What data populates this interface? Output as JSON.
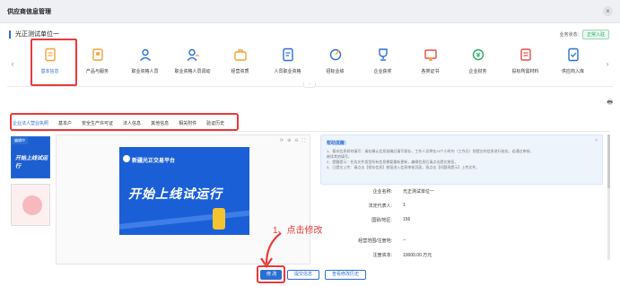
{
  "window": {
    "title": "供应商信息管理",
    "close": "×"
  },
  "company": {
    "name": "光正测试单位一",
    "status_label": "业务状态:",
    "status_value": "正常入驻"
  },
  "nav": [
    {
      "label": "基本信息",
      "icon": "basic-info-icon",
      "active": true
    },
    {
      "label": "产品与服务",
      "icon": "products-icon"
    },
    {
      "label": "职业资格人员",
      "icon": "qualified-staff-icon"
    },
    {
      "label": "职业资格人员调动",
      "icon": "staff-transfer-icon"
    },
    {
      "label": "经营资质",
      "icon": "business-qualification-icon"
    },
    {
      "label": "人员职业资格",
      "icon": "staff-certificate-icon"
    },
    {
      "label": "招标业绩",
      "icon": "bid-performance-icon"
    },
    {
      "label": "企业获奖",
      "icon": "award-icon"
    },
    {
      "label": "各类证书",
      "icon": "certificates-icon"
    },
    {
      "label": "企业财务",
      "icon": "finance-icon"
    },
    {
      "label": "投标所需材料",
      "icon": "bid-materials-icon"
    },
    {
      "label": "供应商入库",
      "icon": "supplier-entry-icon"
    }
  ],
  "tabs": [
    {
      "label": "企业法人营业执照",
      "active": true
    },
    {
      "label": "基本户"
    },
    {
      "label": "安全生产许可证"
    },
    {
      "label": "法人信息"
    },
    {
      "label": "其他信息"
    },
    {
      "label": "相关附件"
    },
    {
      "label": "验证历史"
    }
  ],
  "thumbs": {
    "tag": "编辑中",
    "text": "开始上线试运行"
  },
  "viewer": {
    "brand": "新疆光正交易平台",
    "headline": "开始上线试运行"
  },
  "notice": {
    "heading": "帮助提醒：",
    "lines": [
      "1、基本信息如何填写：请在确认信息准确后填写保存，工作人员将在24个小时内（工作日）到提交的信息进行核实，若通过审核，",
      "      继续其他填写。",
      "2、提醒提示：任务文件类型所有信息需要重新更新，编辑信息后请点击提交按钮，",
      "3、已提交上传：请点击【保存信息】按钮进入信息审核页面，再点击【问题再提示】上传文件。"
    ]
  },
  "form": [
    {
      "label": "企业名称:",
      "value": "光正测试单位一"
    },
    {
      "label": "法定代表人:",
      "value": "1"
    },
    {
      "label": "国别/地区:",
      "value": "156"
    },
    {
      "label": "经营范围/注册地:",
      "value": "--"
    },
    {
      "label": "注册资本:",
      "value": "10000.00 万元"
    }
  ],
  "annotation": "1、点击修改",
  "buttons": {
    "edit": "修 改",
    "save": "提交信息",
    "history": "查看修改历史"
  },
  "colors": {
    "accent": "#2b6fd6",
    "highlight": "#e83a3a",
    "success": "#2aa866"
  }
}
